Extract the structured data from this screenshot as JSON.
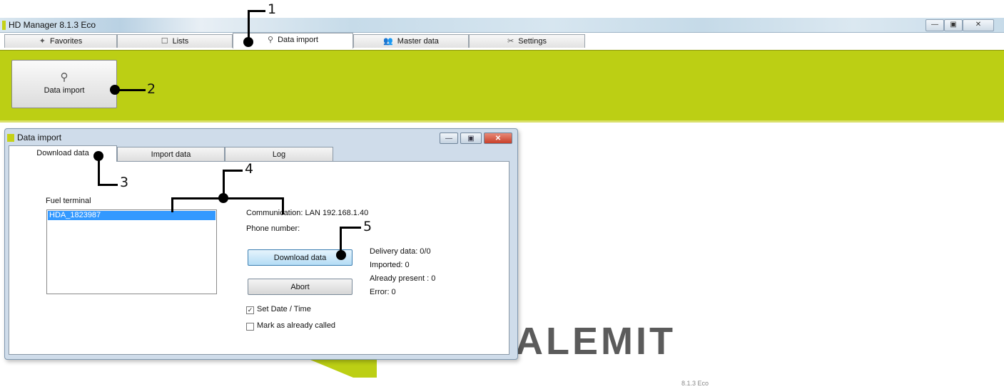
{
  "window": {
    "title": "HD Manager 8.1.3  Eco",
    "controls": {
      "minimize": "—",
      "maximize": "▣",
      "close": "✕"
    }
  },
  "main_tabs": [
    {
      "label": "Favorites",
      "icon": "star-icon",
      "glyph": "✦"
    },
    {
      "label": "Lists",
      "icon": "list-icon",
      "glyph": "☐"
    },
    {
      "label": "Data import",
      "icon": "import-icon",
      "glyph": "⚲"
    },
    {
      "label": "Master data",
      "icon": "users-icon",
      "glyph": "👥"
    },
    {
      "label": "Settings",
      "icon": "tools-icon",
      "glyph": "✂"
    }
  ],
  "ribbon": {
    "button_label": "Data import",
    "button_icon": "import-icon",
    "button_glyph": "⚲"
  },
  "logo": {
    "text": "ALEMIT",
    "version": "8.1.3  Eco"
  },
  "dialog": {
    "title": "Data import",
    "tabs": [
      "Download data",
      "Import data",
      "Log"
    ],
    "fuel_terminal_label": "Fuel terminal",
    "fuel_terminals": [
      "HDA_1823987"
    ],
    "communication": "Communication:  LAN 192.168.1.40",
    "phone": "Phone number:",
    "download_button": "Download data",
    "abort_button": "Abort",
    "stats": {
      "delivery": "Delivery data:  0/0",
      "imported": "Imported:  0",
      "already_present": "Already present :  0",
      "error": "Error:  0"
    },
    "set_date_time": {
      "label": "Set Date / Time",
      "checked": true
    },
    "mark_called": {
      "label": "Mark as already called",
      "checked": false
    }
  },
  "callouts": [
    "1",
    "2",
    "3",
    "4",
    "5"
  ],
  "colors": {
    "accent": "#bccf14",
    "selection": "#3399ff"
  }
}
